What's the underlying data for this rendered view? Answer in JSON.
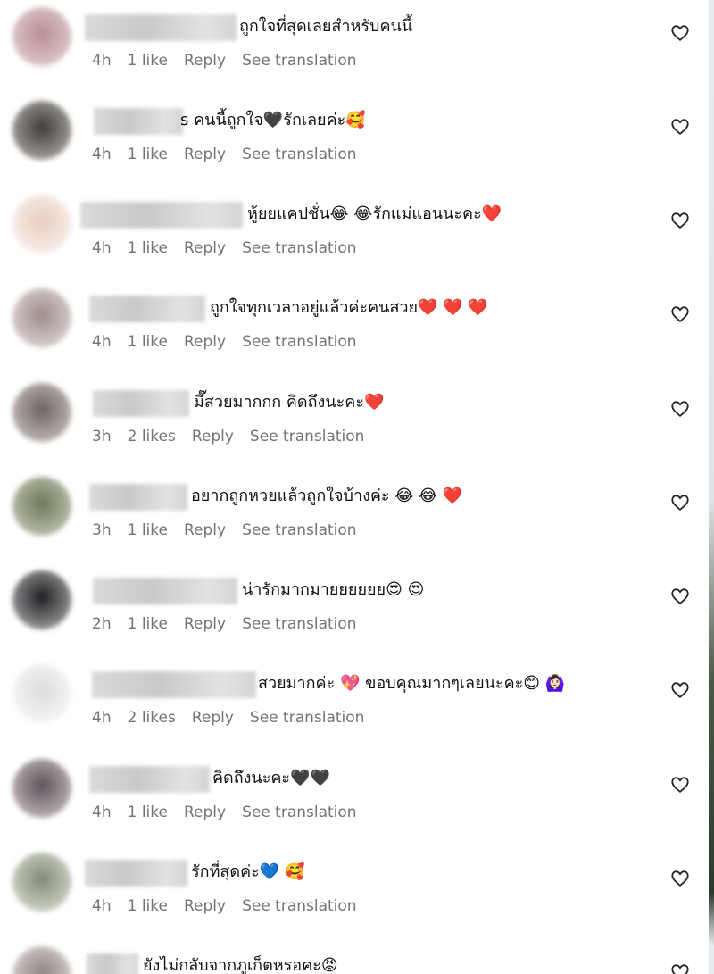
{
  "comments": [
    {
      "time": "4h",
      "likes": "1 like",
      "reply": "Reply",
      "see_translation": "See translation",
      "text": "ถูกใจที่สุดเลยสำหรับคนนี้",
      "avatar_color": "#caa9ad"
    },
    {
      "time": "4h",
      "likes": "1 like",
      "reply": "Reply",
      "see_translation": "See translation",
      "text": "s คนนี้ถูกใจ🖤รักเลยค่ะ🥰",
      "avatar_color": "#6c6a66"
    },
    {
      "time": "4h",
      "likes": "1 like",
      "reply": "Reply",
      "see_translation": "See translation",
      "text": "หู้ยยแคปชั่น😂 😂รักแม่แอนนะคะ❤️",
      "avatar_color": "#f1dfd6"
    },
    {
      "time": "4h",
      "likes": "1 like",
      "reply": "Reply",
      "see_translation": "See translation",
      "text": "ถูกใจทุกเวลาอยู่แล้วค่ะคนสวย❤️ ❤️ ❤️",
      "avatar_color": "#b9a8a6"
    },
    {
      "time": "3h",
      "likes": "2 likes",
      "reply": "Reply",
      "see_translation": "See translation",
      "text": "มี๊สวยมากกก คิดถึงนะคะ❤️",
      "avatar_color": "#8f8683"
    },
    {
      "time": "3h",
      "likes": "1 like",
      "reply": "Reply",
      "see_translation": "See translation",
      "text": "อยากถูกหวยแล้วถูกใจบ้างค่ะ 😂 😂 ❤️",
      "avatar_color": "#8c9479"
    },
    {
      "time": "2h",
      "likes": "1 like",
      "reply": "Reply",
      "see_translation": "See translation",
      "text": "น่ารักมากมายยยยยย😍 😍",
      "avatar_color": "#3d3d3f"
    },
    {
      "time": "4h",
      "likes": "2 likes",
      "reply": "Reply",
      "see_translation": "See translation",
      "text": "สวยมากค่ะ 💖 ขอบคุณมากๆเลยนะคะ😊 🙆🏻‍♀️",
      "avatar_color": "#ececec"
    },
    {
      "time": "4h",
      "likes": "1 like",
      "reply": "Reply",
      "see_translation": "See translation",
      "text": "คิดถึงนะคะ🖤🖤",
      "avatar_color": "#857a80"
    },
    {
      "time": "4h",
      "likes": "1 like",
      "reply": "Reply",
      "see_translation": "See translation",
      "text": "รักที่สุดค่ะ💙 🥰",
      "avatar_color": "#a7ac9e"
    },
    {
      "time": "",
      "likes": "",
      "reply": "",
      "see_translation": "",
      "text": "ยังไม่กลับจากภูเก็ตหรอคะ😡",
      "avatar_color": "#b4aba9"
    }
  ]
}
